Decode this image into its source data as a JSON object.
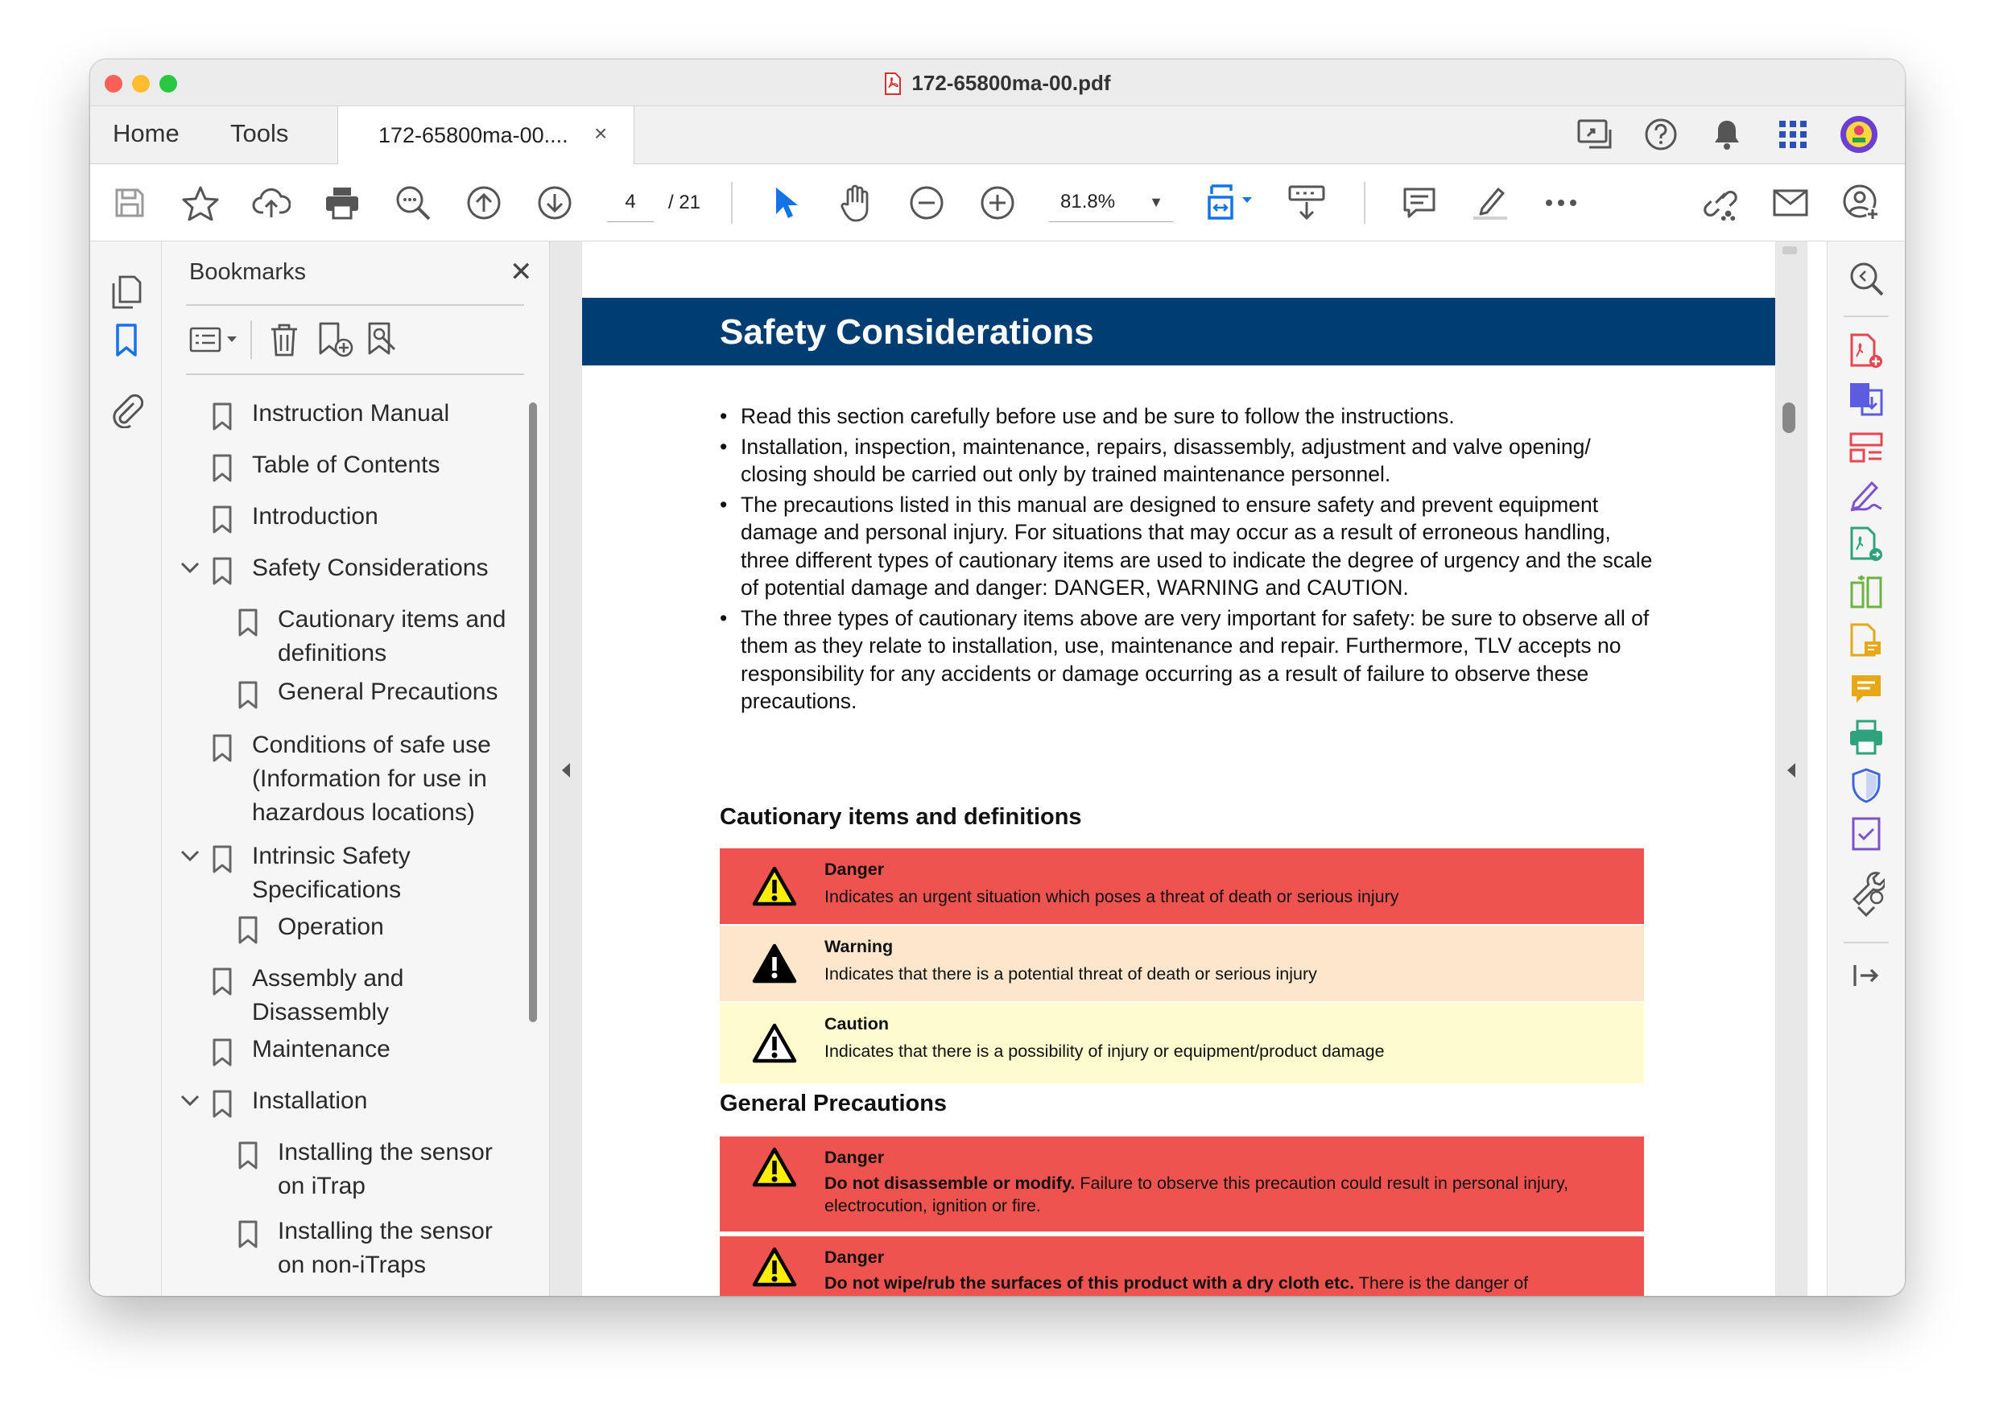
{
  "window": {
    "title": "172-65800ma-00.pdf"
  },
  "tabs": {
    "home": "Home",
    "tools": "Tools",
    "document": "172-65800ma-00....",
    "close": "×"
  },
  "toolbar": {
    "page_current": "4",
    "page_total": "/ 21",
    "zoom": "81.8%"
  },
  "bookmarks": {
    "title": "Bookmarks",
    "close": "✕",
    "items": [
      {
        "label": "Instruction Manual",
        "level": 0,
        "expanded": false
      },
      {
        "label": "Table of Contents",
        "level": 0,
        "expanded": false
      },
      {
        "label": "Introduction",
        "level": 0,
        "expanded": false
      },
      {
        "label": "Safety Considerations",
        "level": 0,
        "expanded": true
      },
      {
        "label": "Cautionary items and definitions",
        "level": 1,
        "expanded": false
      },
      {
        "label": "General Precautions",
        "level": 1,
        "expanded": false
      },
      {
        "label": "Conditions of safe use (Information for use in hazardous locations)",
        "level": 0,
        "expanded": false
      },
      {
        "label": "Intrinsic Safety Specifications",
        "level": 0,
        "expanded": true
      },
      {
        "label": "Operation",
        "level": 1,
        "expanded": false
      },
      {
        "label": "Assembly and Disassembly",
        "level": 0,
        "expanded": false
      },
      {
        "label": "Maintenance",
        "level": 0,
        "expanded": false
      },
      {
        "label": "Installation",
        "level": 0,
        "expanded": true
      },
      {
        "label": "Installing the sensor on iTrap",
        "level": 1,
        "expanded": false
      },
      {
        "label": "Installing the sensor on non-iTraps",
        "level": 1,
        "expanded": false
      }
    ]
  },
  "document": {
    "heading": "Safety Considerations",
    "bullets": [
      "Read this section carefully before use and be sure to follow the instructions.",
      "Installation, inspection, maintenance, repairs, disassembly, adjustment and valve opening/ closing should be carried out only by trained maintenance personnel.",
      "The precautions listed in this manual are designed to ensure safety and prevent equipment damage and personal injury. For situations that may occur as a result of erroneous handling, three different types of cautionary items are used to indicate the degree of urgency and the scale of potential damage and danger: DANGER, WARNING and CAUTION.",
      "The three types of cautionary items above are very important for safety: be sure to observe all of them as they relate to installation, use, maintenance and repair. Furthermore, TLV accepts no responsibility for any accidents or damage occurring as a result of failure to observe these precautions."
    ],
    "section1": "Cautionary items and definitions",
    "definitions": [
      {
        "title": "Danger",
        "text": "Indicates an urgent situation which poses a threat of death or serious injury",
        "bg": "#ef5350"
      },
      {
        "title": "Warning",
        "text": "Indicates that there is a potential threat of death or serious injury",
        "bg": "#fde6cc"
      },
      {
        "title": "Caution",
        "text": "Indicates that there is a possibility of injury or equipment/product damage",
        "bg": "#fefbcf"
      }
    ],
    "section2": "General Precautions",
    "precautions": [
      {
        "title": "Danger",
        "bold": "Do not disassemble or modify.",
        "text": " Failure to observe this precaution could result in personal injury, electrocution, ignition or fire.",
        "bg": "#ef5350"
      },
      {
        "title": "Danger",
        "bold": "Do not wipe/rub the surfaces of this product with a dry cloth etc.",
        "text": " There is the danger of electrostatically charging the unit, which may result in ignition or explosions, especially in hazardous locations.",
        "bg": "#ef5350"
      }
    ]
  },
  "colors": {
    "accent": "#1473e6",
    "banner": "#003d73",
    "danger": "#ef5350",
    "warning": "#fde6cc",
    "caution": "#fefbcf"
  }
}
